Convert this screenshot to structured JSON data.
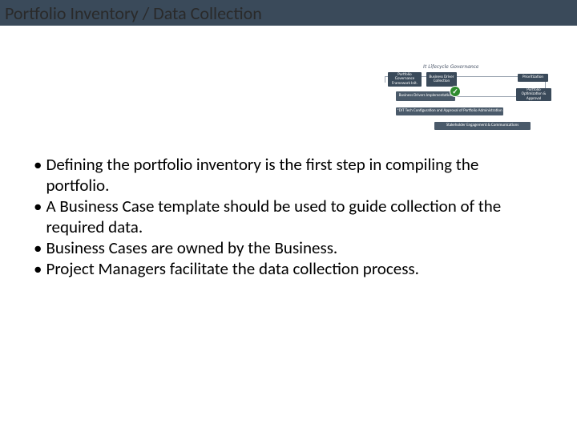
{
  "title": "Portfolio Inventory / Data Collection",
  "diagram": {
    "heading": "It Lifecycle Governance",
    "boxes": {
      "a1": "Portfolio Governance Framework Init.",
      "a2": "Business Driver Collection",
      "a3": "Prioritization",
      "b1": "Business Drivers Implementation",
      "b2": "Portfolio Optimization & Approval",
      "c1": "*DIT Tech Configuration and Approval of Portfolio Administration",
      "d1": "Stakeholder Engagement & Communications"
    }
  },
  "bullets": [
    "Defining the portfolio inventory is the first step in compiling the portfolio.",
    "A Business Case template should be used to guide collection of the required data.",
    "Business Cases are owned by the Business.",
    "Project Managers facilitate the data collection process."
  ]
}
